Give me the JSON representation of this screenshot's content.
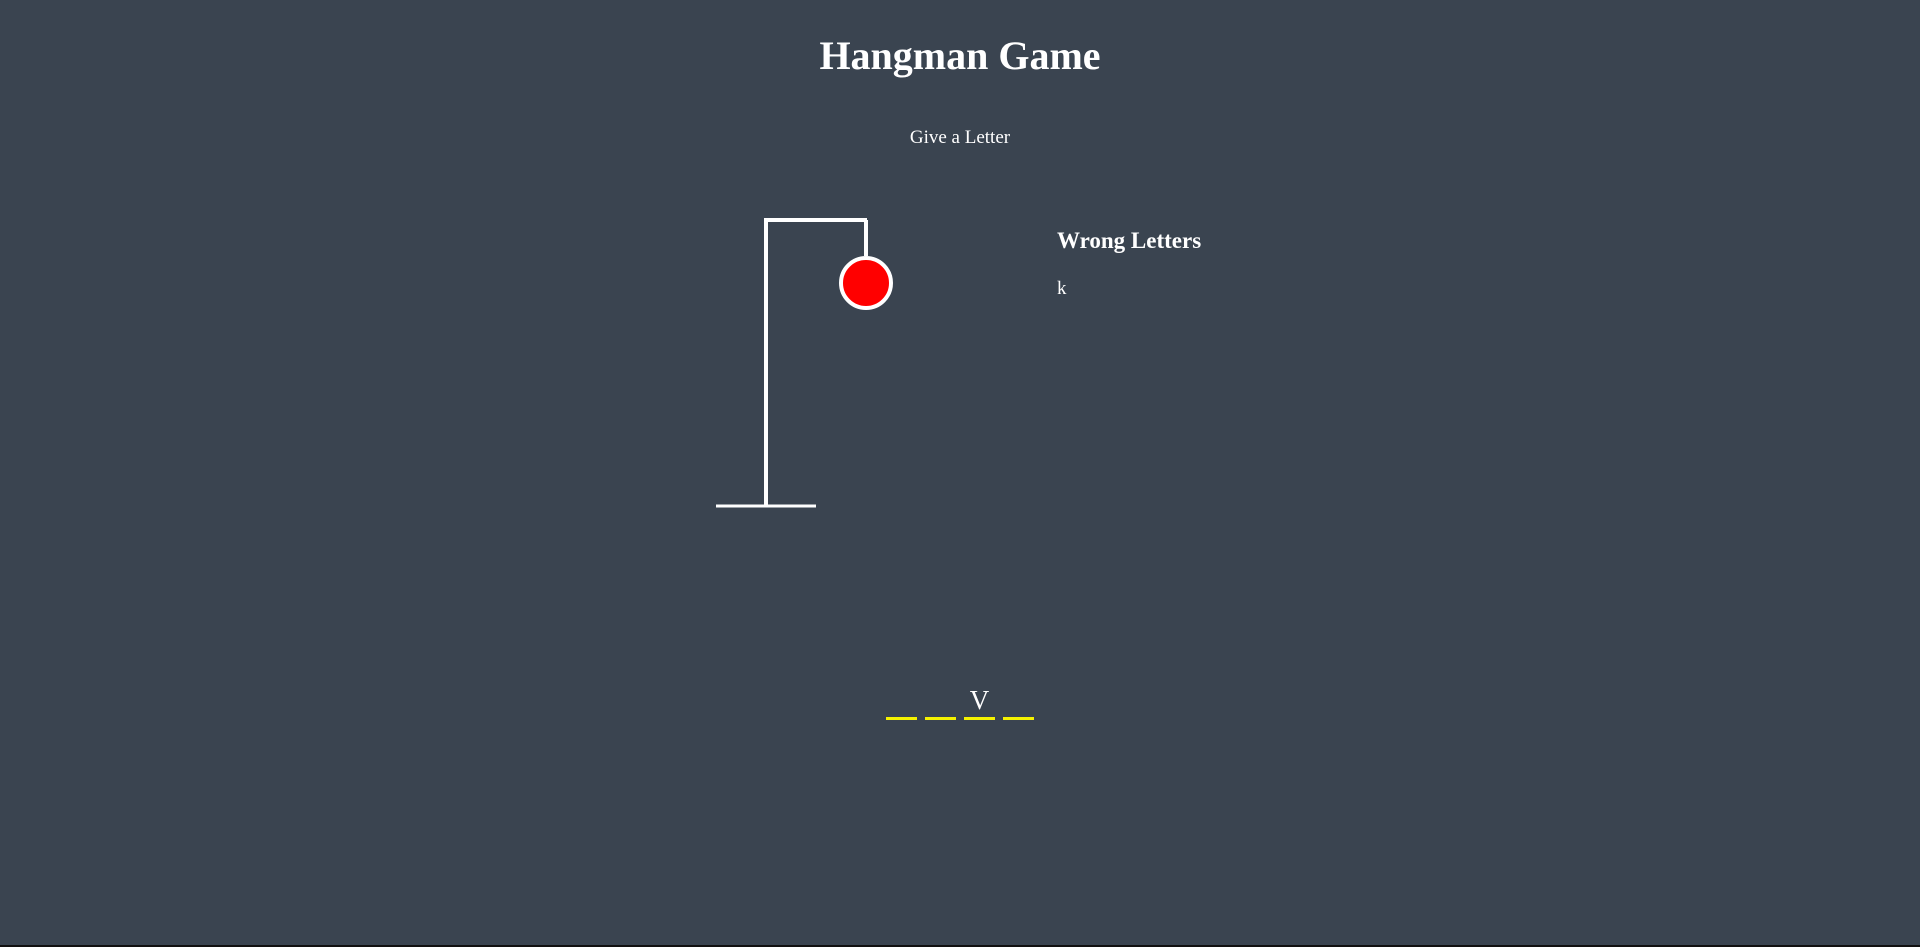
{
  "header": {
    "title": "Hangman Game",
    "prompt": "Give a Letter"
  },
  "hangman": {
    "parts_shown": [
      "head"
    ],
    "head_color": "#ff0000",
    "line_color": "#ffffff"
  },
  "wrong_letters": {
    "title": "Wrong Letters",
    "letters": "k"
  },
  "word": {
    "slots": [
      "",
      "",
      "V",
      ""
    ],
    "underline_color": "#f5f200"
  },
  "colors": {
    "background": "#3a4450",
    "text": "#ffffff"
  }
}
